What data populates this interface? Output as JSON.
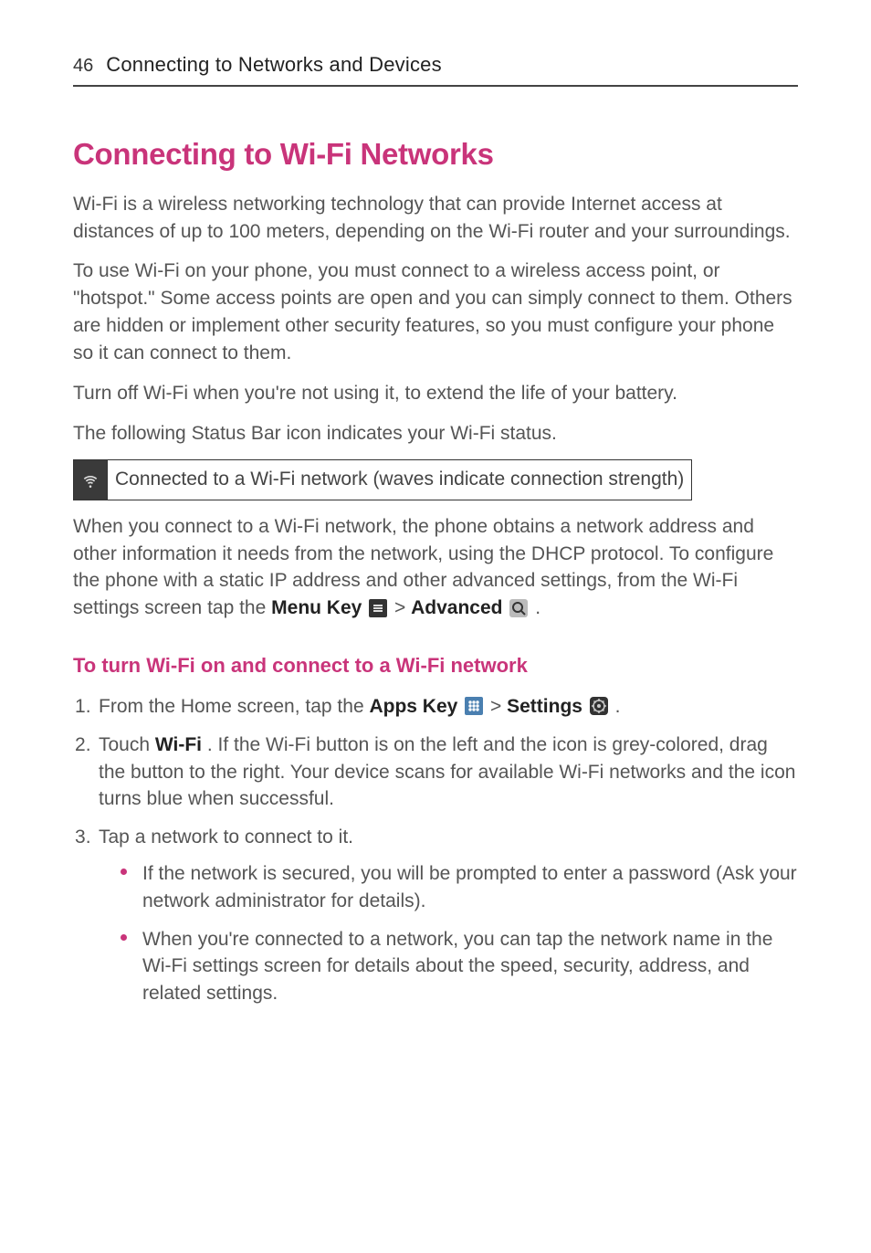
{
  "header": {
    "page_number": "46",
    "title": "Connecting to Networks and Devices"
  },
  "main_heading": "Connecting to Wi-Fi Networks",
  "intro": {
    "p1": "Wi-Fi is a wireless networking technology that can provide Internet access at distances of up to 100 meters, depending on the Wi-Fi router and your surroundings.",
    "p2": "To use Wi-Fi on your phone, you must connect to a wireless access point, or \"hotspot.\" Some access points are open and you can simply connect to them. Others are hidden or implement other security features, so you must configure your phone so it can connect to them.",
    "p3": "Turn off Wi-Fi when you're not using it, to extend the life of your battery.",
    "p4": "The following Status Bar icon indicates your Wi-Fi status."
  },
  "status_table": {
    "row1_label": "Connected to a Wi-Fi network (waves indicate connection strength)"
  },
  "dhcp_para": {
    "text1": "When you connect to a Wi-Fi network, the phone obtains a network address and other information it needs from the network, using the DHCP protocol. To configure the phone with a static IP address and other advanced settings, from the Wi-Fi settings screen tap the ",
    "menu_key": "Menu Key",
    "gt": " > ",
    "advanced": "Advanced",
    "period": "."
  },
  "sub_heading": "To turn Wi-Fi on and connect to a Wi-Fi network",
  "steps": {
    "s1": {
      "pre": "From the Home screen, tap the ",
      "apps_key": "Apps Key",
      "gt": " > ",
      "settings": "Settings",
      "post": "."
    },
    "s2": {
      "pre": "Touch ",
      "wifi": "Wi-Fi",
      "post": ". If the Wi-Fi button is on the left and the icon is grey-colored, drag the button to the right. Your device scans for available Wi-Fi networks and the icon turns blue when successful."
    },
    "s3": {
      "text": "Tap a network to connect to it.",
      "bullets": {
        "b1": "If the network is secured, you will be prompted to enter a password (Ask your network administrator for details).",
        "b2": "When you're connected to a network, you can tap the network name in the Wi-Fi settings screen for details about the speed, security, address, and related settings."
      }
    }
  },
  "icons": {
    "wifi_status": "wifi-icon",
    "menu_key": "menu-key-icon",
    "advanced": "advanced-icon",
    "apps_key": "apps-key-icon",
    "settings": "settings-icon"
  }
}
